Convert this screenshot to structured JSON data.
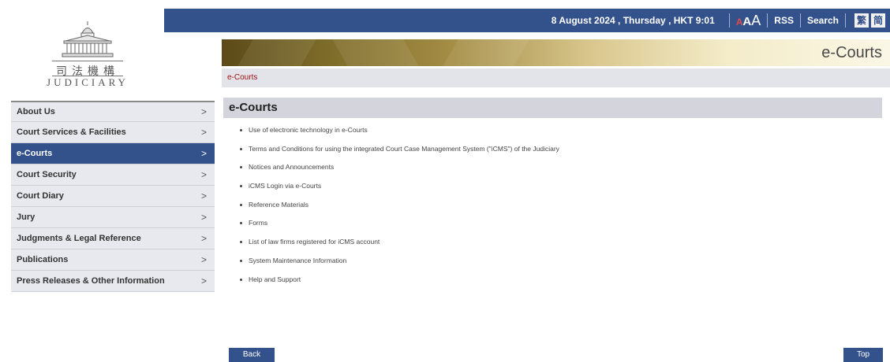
{
  "header": {
    "date": "8 August 2024 , Thursday , HKT 9:01",
    "font_size_labels": [
      "A",
      "A",
      "A"
    ],
    "rss": "RSS",
    "search": "Search",
    "lang_trad": "繁",
    "lang_simp": "简"
  },
  "logo": {
    "zh": "司法機構",
    "en": "JUDICIARY"
  },
  "banner": {
    "title": "e-Courts"
  },
  "breadcrumb": {
    "current": "e-Courts"
  },
  "sidebar": {
    "items": [
      {
        "label": "About Us"
      },
      {
        "label": "Court Services & Facilities"
      },
      {
        "label": "e-Courts"
      },
      {
        "label": "Court Security"
      },
      {
        "label": "Court Diary"
      },
      {
        "label": "Jury"
      },
      {
        "label": "Judgments & Legal Reference"
      },
      {
        "label": "Publications"
      },
      {
        "label": "Press Releases & Other Information"
      }
    ],
    "chevron": ">"
  },
  "main": {
    "title": "e-Courts",
    "links": [
      "Use of electronic technology in e-Courts",
      "Terms and Conditions for using the integrated Court Case Management System (\"iCMS\") of the Judiciary",
      "Notices and Announcements",
      "iCMS Login via e-Courts",
      "Reference Materials",
      "Forms",
      "List of law firms registered for iCMS account",
      "System Maintenance Information",
      "Help and Support"
    ]
  },
  "footer": {
    "back": "Back",
    "top": "Top"
  },
  "colors": {
    "navy": "#33518a",
    "accent_red": "#a01010"
  }
}
